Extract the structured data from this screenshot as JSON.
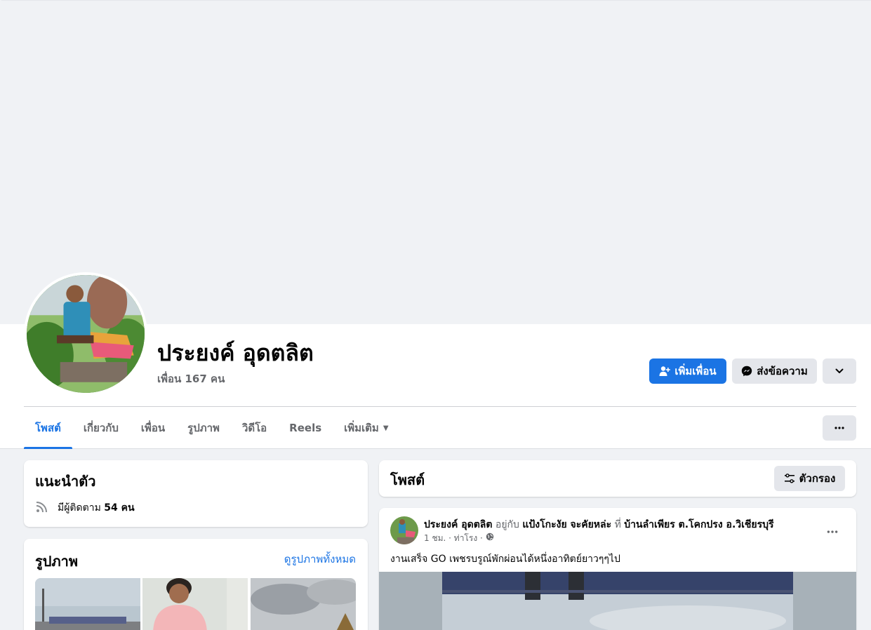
{
  "profile": {
    "name": "ประยงค์ อุดตลิต",
    "friends": "เพื่อน 167 คน"
  },
  "actions": {
    "add_friend": "เพิ่มเพื่อน",
    "message": "ส่งข้อความ"
  },
  "tabs": [
    {
      "label": "โพสต์"
    },
    {
      "label": "เกี่ยวกับ"
    },
    {
      "label": "เพื่อน"
    },
    {
      "label": "รูปภาพ"
    },
    {
      "label": "วิดีโอ"
    },
    {
      "label": "Reels"
    },
    {
      "label": "เพิ่มเติม"
    }
  ],
  "intro": {
    "title": "แนะนำตัว",
    "followers_prefix": "มีผู้ติดตาม ",
    "followers_count": "54 คน"
  },
  "photos": {
    "title": "รูปภาพ",
    "see_all": "ดูรูปภาพทั้งหมด"
  },
  "posts_header": {
    "title": "โพสต์",
    "filter": "ตัวกรอง"
  },
  "post": {
    "author": "ประยงค์ อุดตลิต",
    "with_word": " อยู่กับ ",
    "with_name": "แป้งโกะงัย จะคัยหล่ะ",
    "at_word": " ที่ ",
    "place": "บ้านลำเพียร ต.โคกปรง อ.วิเชียรบุรี",
    "time": "1 ชม.",
    "sep": " · ",
    "location": "ท่าโรง",
    "text": "งานเสร็จ GO เพชรบรูณ์พักผ่อนได้หนึ่งอาทิตย์ยาวๆๆไป"
  },
  "colors": {
    "accent": "#1b74e4",
    "page_bg": "#f0f2f5",
    "secondary_text": "#65676b"
  }
}
